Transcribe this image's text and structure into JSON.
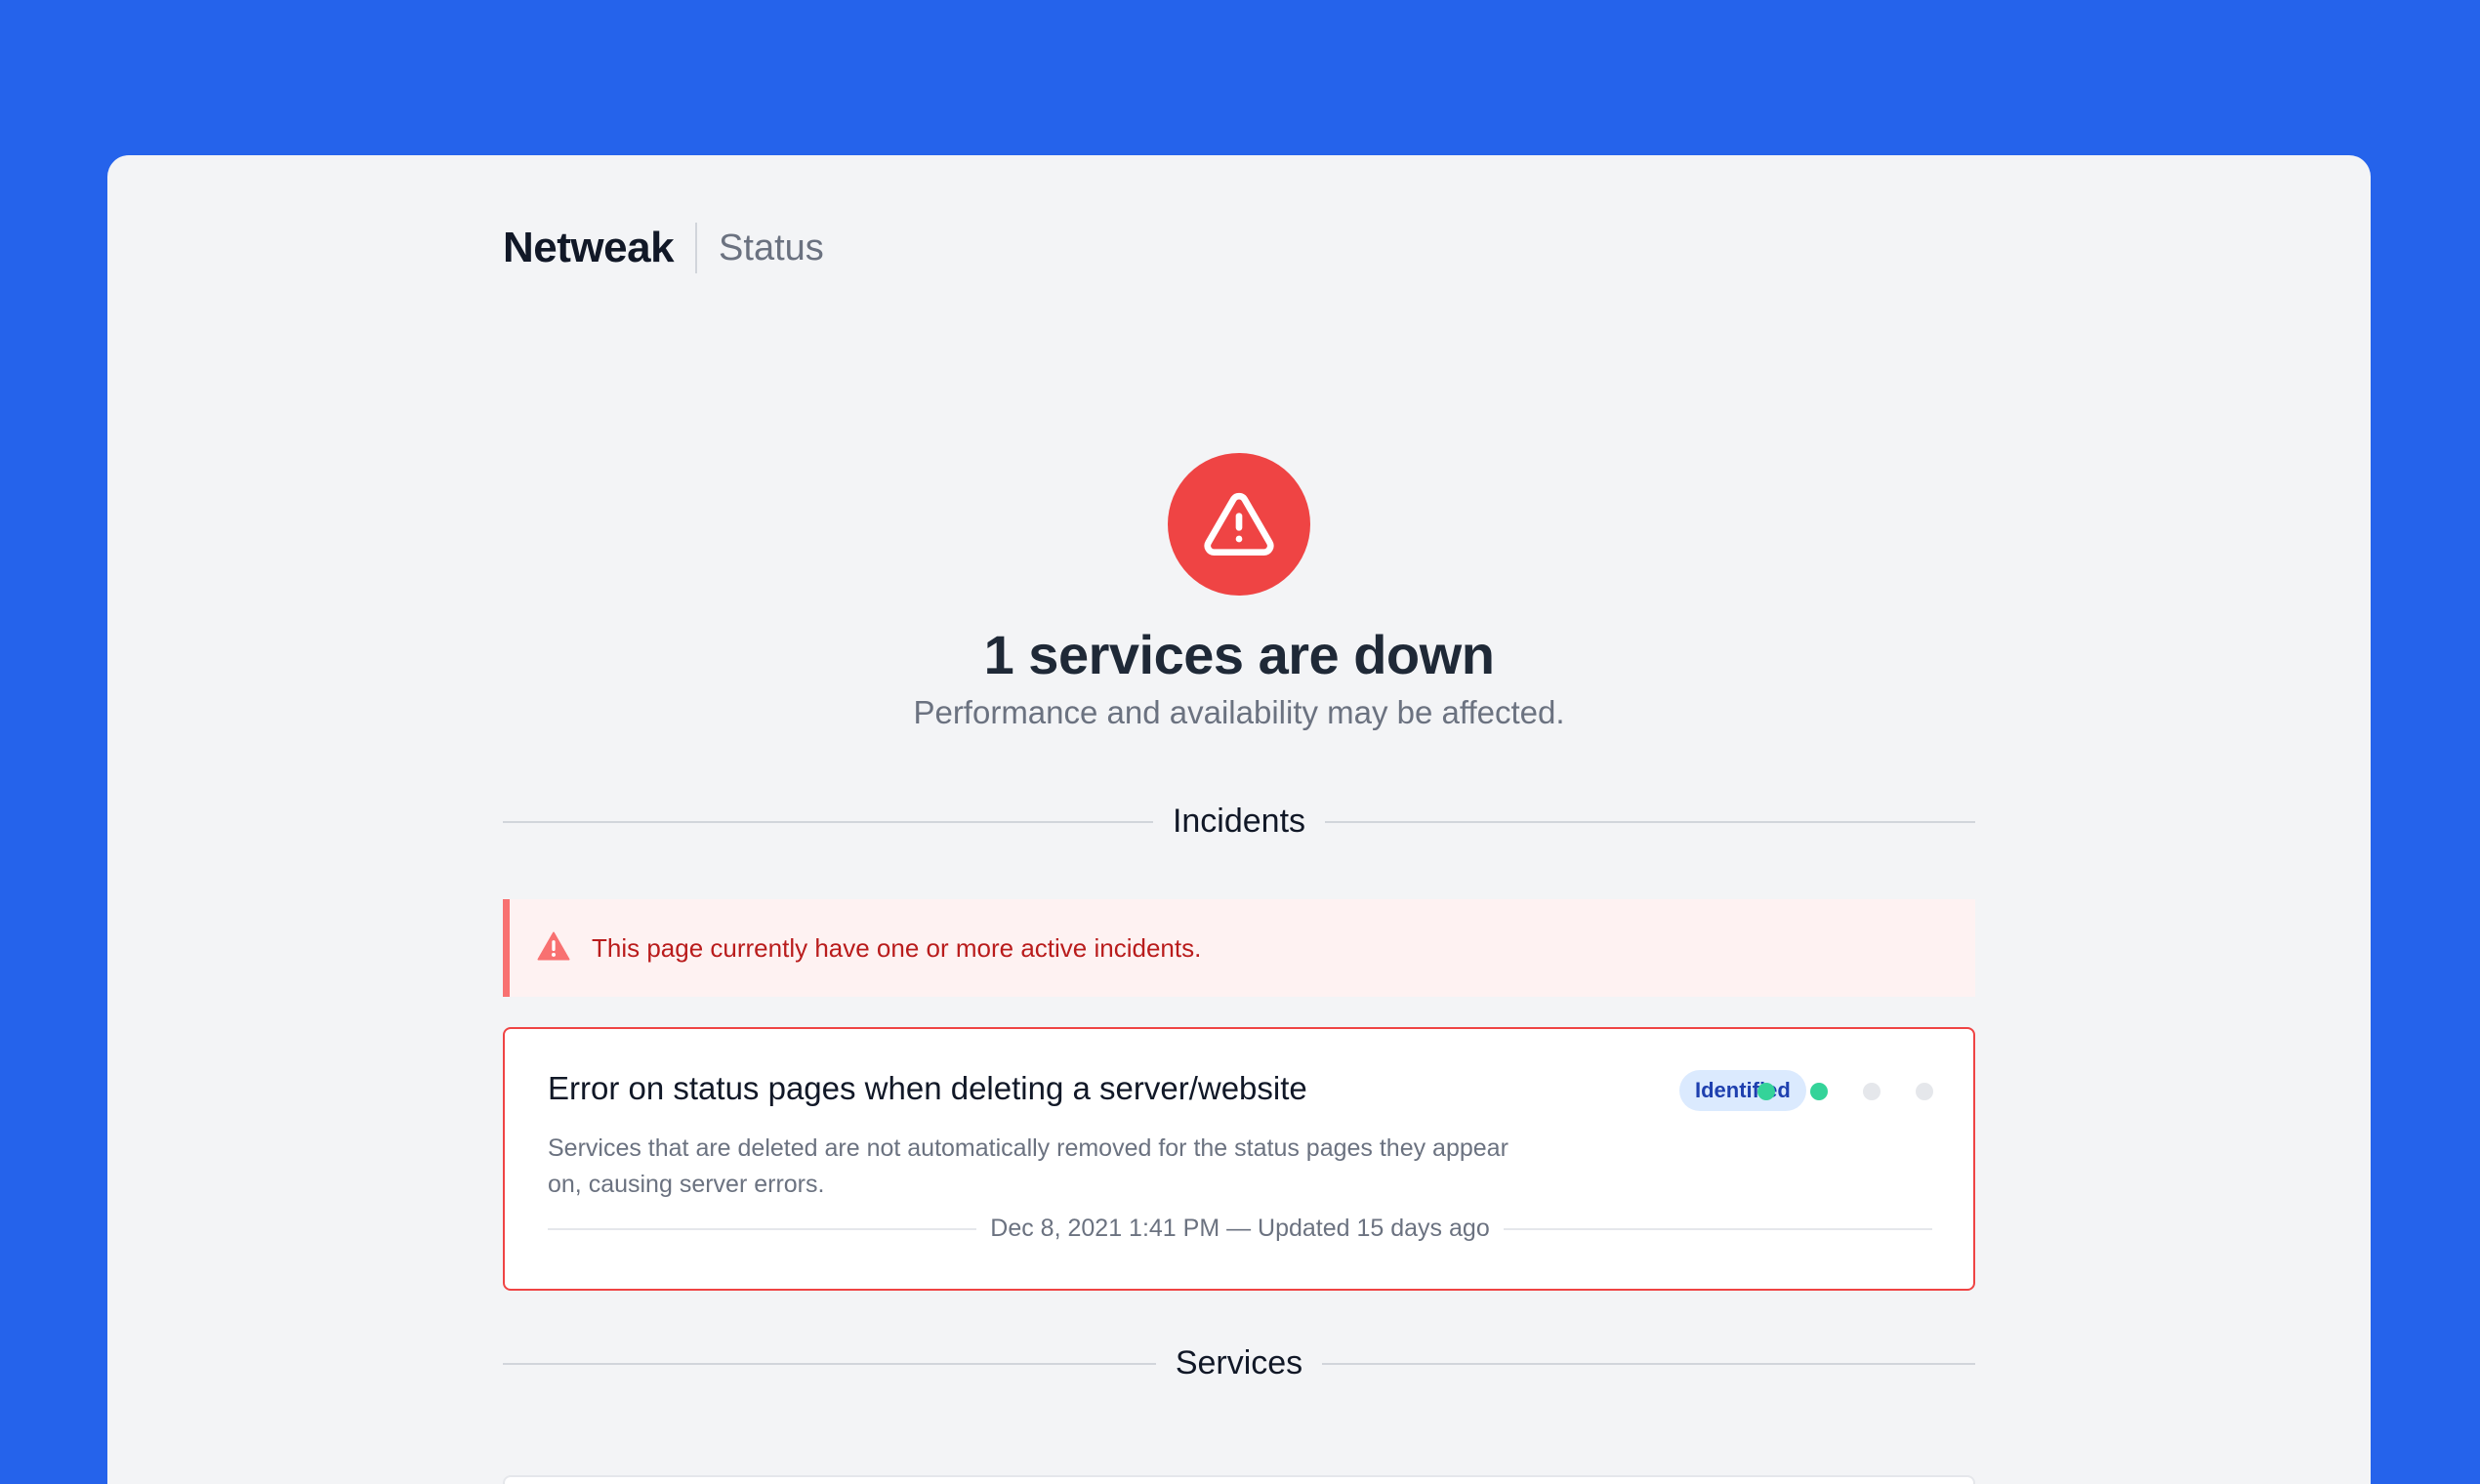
{
  "header": {
    "brand": "Netweak",
    "section": "Status"
  },
  "hero": {
    "icon": "warning-triangle-icon",
    "title": "1 services are down",
    "subtitle": "Performance and availability may be affected.",
    "color": "#ef4444"
  },
  "incidents": {
    "heading": "Incidents",
    "alert": {
      "icon": "alert-triangle-icon",
      "text": "This page currently have one or more active incidents."
    },
    "items": [
      {
        "title": "Error on status pages when deleting a server/website",
        "status": "Identified",
        "description": "Services that are deleted are not automatically removed for the status pages they appear on, causing server errors.",
        "meta": "Dec 8, 2021 1:41 PM — Updated 15 days ago",
        "progress_dots": [
          "active",
          "active",
          "inactive",
          "inactive"
        ]
      }
    ]
  },
  "services": {
    "heading": "Services"
  },
  "colors": {
    "background": "#2563eb",
    "danger": "#ef4444",
    "dot_active": "#34d399",
    "dot_inactive": "#e5e7eb"
  }
}
